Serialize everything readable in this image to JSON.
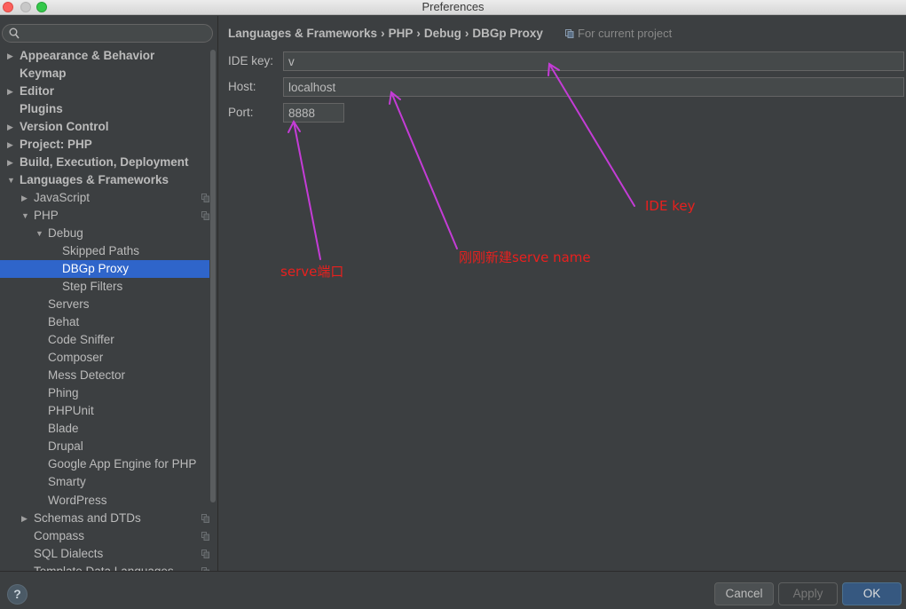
{
  "window": {
    "title": "Preferences"
  },
  "search": {
    "placeholder": "",
    "value": ""
  },
  "sidebar": {
    "items": [
      {
        "label": "Appearance & Behavior",
        "level": 0,
        "arrow": "right",
        "bold": true,
        "copy": false,
        "selected": false
      },
      {
        "label": "Keymap",
        "level": 0,
        "arrow": "none",
        "bold": true,
        "copy": false,
        "selected": false
      },
      {
        "label": "Editor",
        "level": 0,
        "arrow": "right",
        "bold": true,
        "copy": false,
        "selected": false
      },
      {
        "label": "Plugins",
        "level": 0,
        "arrow": "none",
        "bold": true,
        "copy": false,
        "selected": false
      },
      {
        "label": "Version Control",
        "level": 0,
        "arrow": "right",
        "bold": true,
        "copy": false,
        "selected": false
      },
      {
        "label": "Project: PHP",
        "level": 0,
        "arrow": "right",
        "bold": true,
        "copy": false,
        "selected": false
      },
      {
        "label": "Build, Execution, Deployment",
        "level": 0,
        "arrow": "right",
        "bold": true,
        "copy": false,
        "selected": false
      },
      {
        "label": "Languages & Frameworks",
        "level": 0,
        "arrow": "down",
        "bold": true,
        "copy": false,
        "selected": false
      },
      {
        "label": "JavaScript",
        "level": 1,
        "arrow": "right",
        "bold": false,
        "copy": true,
        "selected": false
      },
      {
        "label": "PHP",
        "level": 1,
        "arrow": "down",
        "bold": false,
        "copy": true,
        "selected": false
      },
      {
        "label": "Debug",
        "level": 2,
        "arrow": "down",
        "bold": false,
        "copy": false,
        "selected": false
      },
      {
        "label": "Skipped Paths",
        "level": 3,
        "arrow": "none",
        "bold": false,
        "copy": false,
        "selected": false
      },
      {
        "label": "DBGp Proxy",
        "level": 3,
        "arrow": "none",
        "bold": false,
        "copy": false,
        "selected": true
      },
      {
        "label": "Step Filters",
        "level": 3,
        "arrow": "none",
        "bold": false,
        "copy": false,
        "selected": false
      },
      {
        "label": "Servers",
        "level": 2,
        "arrow": "none",
        "bold": false,
        "copy": false,
        "selected": false
      },
      {
        "label": "Behat",
        "level": 2,
        "arrow": "none",
        "bold": false,
        "copy": false,
        "selected": false
      },
      {
        "label": "Code Sniffer",
        "level": 2,
        "arrow": "none",
        "bold": false,
        "copy": false,
        "selected": false
      },
      {
        "label": "Composer",
        "level": 2,
        "arrow": "none",
        "bold": false,
        "copy": false,
        "selected": false
      },
      {
        "label": "Mess Detector",
        "level": 2,
        "arrow": "none",
        "bold": false,
        "copy": false,
        "selected": false
      },
      {
        "label": "Phing",
        "level": 2,
        "arrow": "none",
        "bold": false,
        "copy": false,
        "selected": false
      },
      {
        "label": "PHPUnit",
        "level": 2,
        "arrow": "none",
        "bold": false,
        "copy": false,
        "selected": false
      },
      {
        "label": "Blade",
        "level": 2,
        "arrow": "none",
        "bold": false,
        "copy": false,
        "selected": false
      },
      {
        "label": "Drupal",
        "level": 2,
        "arrow": "none",
        "bold": false,
        "copy": false,
        "selected": false
      },
      {
        "label": "Google App Engine for PHP",
        "level": 2,
        "arrow": "none",
        "bold": false,
        "copy": false,
        "selected": false
      },
      {
        "label": "Smarty",
        "level": 2,
        "arrow": "none",
        "bold": false,
        "copy": false,
        "selected": false
      },
      {
        "label": "WordPress",
        "level": 2,
        "arrow": "none",
        "bold": false,
        "copy": false,
        "selected": false
      },
      {
        "label": "Schemas and DTDs",
        "level": 1,
        "arrow": "right",
        "bold": false,
        "copy": true,
        "selected": false
      },
      {
        "label": "Compass",
        "level": 1,
        "arrow": "none",
        "bold": false,
        "copy": true,
        "selected": false
      },
      {
        "label": "SQL Dialects",
        "level": 1,
        "arrow": "none",
        "bold": false,
        "copy": true,
        "selected": false
      },
      {
        "label": "Template Data Languages",
        "level": 1,
        "arrow": "none",
        "bold": false,
        "copy": true,
        "selected": false
      }
    ]
  },
  "breadcrumb": {
    "parts": [
      "Languages & Frameworks",
      "PHP",
      "Debug",
      "DBGp Proxy"
    ],
    "separator": "›",
    "scope": "For current project"
  },
  "form": {
    "ide_key": {
      "label": "IDE key:",
      "value": "v"
    },
    "host": {
      "label": "Host:",
      "value": "localhost"
    },
    "port": {
      "label": "Port:",
      "value": "8888"
    }
  },
  "annotations": {
    "ide_key": "IDE key",
    "host": "刚刚新建serve name",
    "port": "serve端口",
    "color": "#e8201e",
    "arrow_color": "#c43cd6"
  },
  "footer": {
    "help": "?",
    "cancel": "Cancel",
    "apply": "Apply",
    "ok": "OK"
  },
  "colors": {
    "background": "#3c3f41",
    "selection": "#2f65ca",
    "ok_button": "#365880"
  }
}
